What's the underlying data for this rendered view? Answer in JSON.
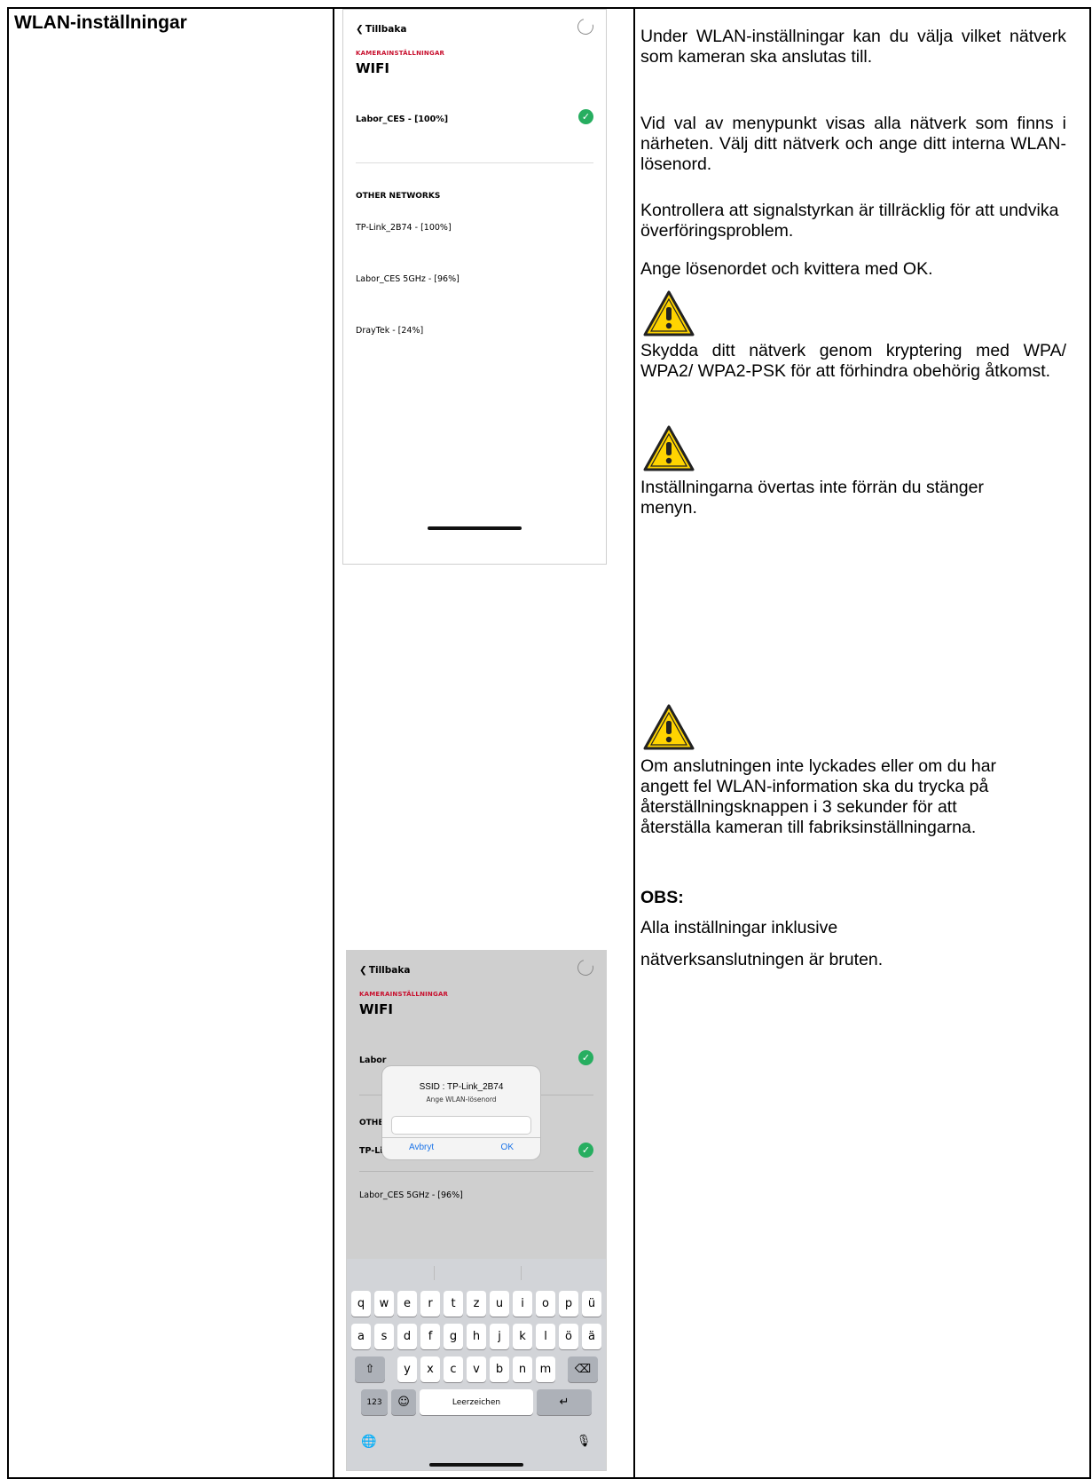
{
  "section_title": "WLAN-inställningar",
  "phone_screen_1": {
    "back_label": "Tillbaka",
    "back_chevron": "❮",
    "kicker": "KAMERAINSTÄLLNINGAR",
    "title": "WIFI",
    "connected_network": "Labor_CES - [100%]",
    "check_glyph": "✓",
    "other_networks_header": "OTHER NETWORKS",
    "other_networks": [
      "TP-Link_2B74 - [100%]",
      "Labor_CES 5GHz - [96%]",
      "DrayTek - [24%]"
    ]
  },
  "phone_screen_2": {
    "back_label": "Tillbaka",
    "back_chevron": "❮",
    "kicker": "KAMERAINSTÄLLNINGAR",
    "title": "WIFI",
    "partial_connected": "Labor",
    "partial_other_header": "OTHER",
    "partial_tplink": "TP-Link",
    "network_5ghz": "Labor_CES 5GHz - [96%]",
    "dialog": {
      "title": "SSID : TP-Link_2B74",
      "subtitle": "Ange WLAN-lösenord",
      "cancel": "Avbryt",
      "ok": "OK"
    },
    "keyboard": {
      "row1": [
        "q",
        "w",
        "e",
        "r",
        "t",
        "z",
        "u",
        "i",
        "o",
        "p",
        "ü"
      ],
      "row2": [
        "a",
        "s",
        "d",
        "f",
        "g",
        "h",
        "j",
        "k",
        "l",
        "ö",
        "ä"
      ],
      "row3": [
        "y",
        "x",
        "c",
        "v",
        "b",
        "n",
        "m"
      ],
      "shift": "⇧",
      "backspace": "⌫",
      "numbers": "123",
      "emoji": "☺",
      "space": "Leerzeichen",
      "return": "↵",
      "globe": "🌐",
      "mic": "🎙"
    }
  },
  "description": {
    "p1": "Under WLAN-inställningar kan du välja vilket nätverk som kameran ska anslutas till.",
    "p2": "Vid val av menypunkt visas alla nätverk som finns i närheten. Välj ditt nätverk och ange ditt interna WLAN-lösenord.",
    "p3": "Kontrollera att signalstyrkan är tillräcklig för att undvika överföringsproblem.",
    "p4": "Ange lösenordet och kvittera med OK.",
    "warning1": "Skydda ditt nätverk genom kryptering med WPA/ WPA2/ WPA2-PSK för att förhindra obehörig åtkomst.",
    "warning2": "Inställningarna övertas inte förrän du stänger menyn.",
    "warning3": "Om anslutningen inte lyckades eller om du har angett fel WLAN-information ska du trycka på återställningsknappen i 3 sekunder för att återställa kameran till fabriksinställningarna.",
    "note_heading": "OBS:",
    "note_line1": "Alla inställningar inklusive",
    "note_line2": "nätverksanslutningen är bruten."
  },
  "colors": {
    "accent_red": "#c8102e",
    "check_green": "#27ae60",
    "warning_yellow": "#ffd400",
    "link_blue": "#1a73e8"
  }
}
